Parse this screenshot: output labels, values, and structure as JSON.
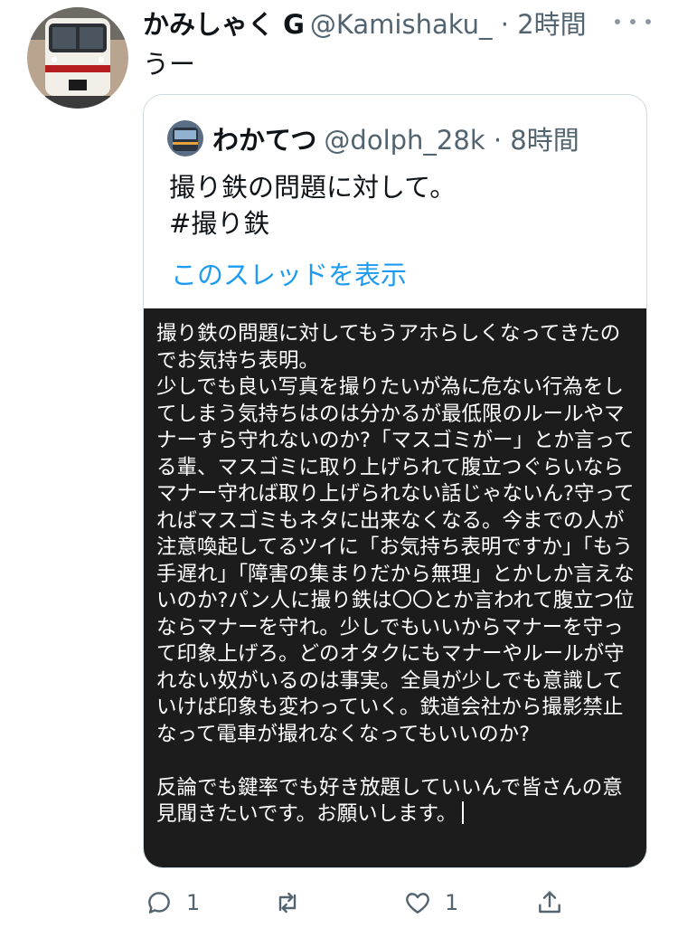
{
  "tweet": {
    "author_name": "かみしゃく G",
    "author_meta": "@Kamishaku_ · 2時間",
    "text": "うー"
  },
  "quoted": {
    "author_name": "わかてつ",
    "author_meta": "@dolph_28k · 8時間",
    "text_line1": "撮り鉄の問題に対して。",
    "text_line2": " #撮り鉄",
    "thread_link": "このスレッドを表示",
    "image_text": "撮り鉄の問題に対してもうアホらしくなってきたのでお気持ち表明。\n少しでも良い写真を撮りたいが為に危ない行為をしてしまう気持ちはのは分かるが最低限のルールやマナーすら守れないのか?「マスゴミがー」とか言ってる輩、マスゴミに取り上げられて腹立つぐらいならマナー守れば取り上げられない話じゃないん?守ってればマスゴミもネタに出来なくなる。今までの人が注意喚起してるツイに「お気持ち表明ですか」「もう手遅れ」「障害の集まりだから無理」とかしか言えないのか?パン人に撮り鉄は〇〇とか言われて腹立つ位ならマナーを守れ。少しでもいいからマナーを守って印象上げろ。どのオタクにもマナーやルールが守れない奴がいるのは事実。全員が少しでも意識していけば印象も変わっていく。鉄道会社から撮影禁止なって電車が撮れなくなってもいいのか?\n\n反論でも鍵率でも好き放題していいんで皆さんの意見聞きたいです。お願いします。"
  },
  "actions": {
    "reply_count": "1",
    "retweet_count": "",
    "like_count": "1"
  },
  "icons": {
    "reply": "reply-icon",
    "retweet": "retweet-icon",
    "like": "like-icon",
    "share": "share-icon",
    "more": "more-icon"
  },
  "colors": {
    "link": "#1d9bf0",
    "secondary_text": "#536471",
    "panel_background": "#1c1c1c"
  }
}
